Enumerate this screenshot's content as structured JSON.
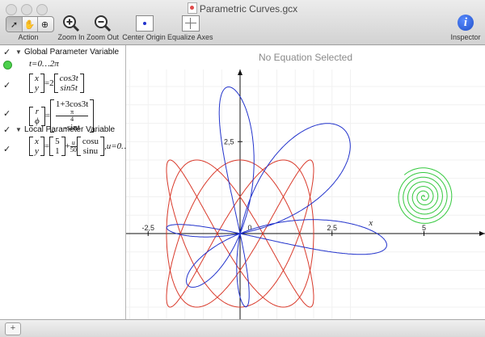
{
  "window": {
    "title": "Parametric Curves.gcx"
  },
  "toolbar": {
    "action_label": "Action",
    "zoom_in_label": "Zoom In",
    "zoom_out_label": "Zoom Out",
    "center_origin_label": "Center Origin",
    "equalize_axes_label": "Equalize Axes",
    "inspector_label": "Inspector"
  },
  "sidebar": {
    "global_header": "Global Parameter Variable",
    "global_param": "t=0…2π",
    "eq1_scale": "=2",
    "eq1_lhs": [
      "x",
      "y"
    ],
    "eq1_rhs": [
      "cos3t",
      "sin5t"
    ],
    "eq2_lhs": [
      "r",
      "ϕ"
    ],
    "eq2_rhs_top": "1+3cos3t",
    "eq2_rhs_frac_num": "π",
    "eq2_rhs_frac_den": "4",
    "eq2_rhs_bottom_tail": "-sint",
    "local_header": "Local Parameter Variable",
    "eq3_lhs": [
      "x",
      "y"
    ],
    "eq3_const": [
      "5",
      "1"
    ],
    "eq3_frac_num": "u",
    "eq3_frac_den": "50",
    "eq3_rhs": [
      "cosu",
      "sinu"
    ],
    "eq3_tail": ",u=0…"
  },
  "canvas": {
    "status": "No Equation Selected",
    "x_ticks": [
      "-2,5",
      "0",
      "2,5",
      "5"
    ],
    "y_ticks": [
      "2,5"
    ],
    "x_axis_label": "x",
    "colors": {
      "blue": "#2233cc",
      "red": "#d93a2b",
      "green": "#32c83c"
    }
  },
  "bottom": {
    "add_label": "+"
  }
}
